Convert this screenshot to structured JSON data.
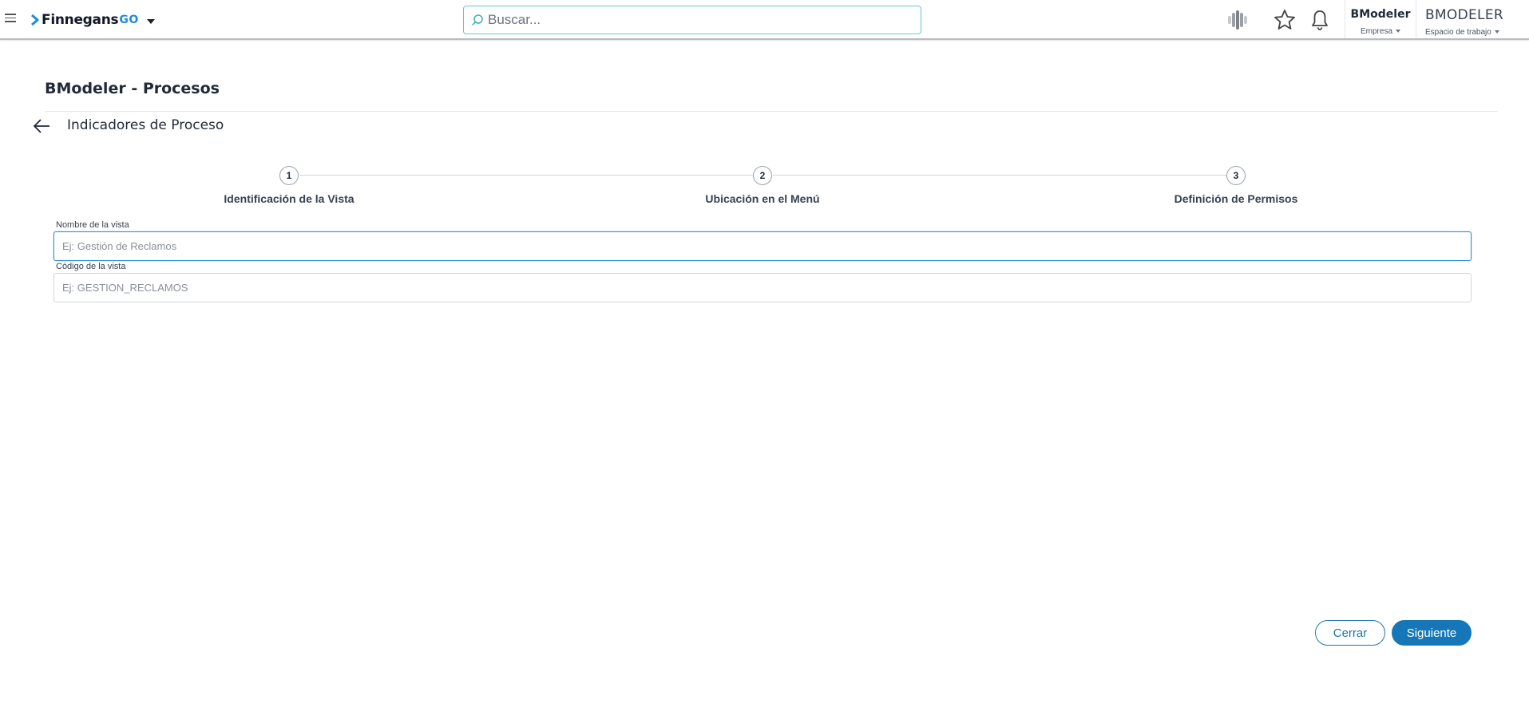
{
  "topbar": {
    "brand": "Finnegans",
    "brand_suffix": "GO",
    "search_placeholder": "Buscar...",
    "company": {
      "name": "BModeler",
      "label": "Empresa"
    },
    "workspace": {
      "name": "BMODELER",
      "label": "Espacio de trabajo"
    }
  },
  "page": {
    "title": "BModeler - Procesos",
    "subtitle": "Indicadores de Proceso"
  },
  "stepper": {
    "steps": [
      {
        "number": "1",
        "label": "Identificación de la Vista"
      },
      {
        "number": "2",
        "label": "Ubicación en el Menú"
      },
      {
        "number": "3",
        "label": "Definición de Permisos"
      }
    ]
  },
  "form": {
    "view_name": {
      "label": "Nombre de la vista",
      "placeholder": "Ej: Gestión de Reclamos",
      "value": ""
    },
    "view_code": {
      "label": "Código de la vista",
      "placeholder": "Ej: GESTION_RECLAMOS",
      "value": ""
    }
  },
  "actions": {
    "close_label": "Cerrar",
    "next_label": "Siguiente"
  },
  "colors": {
    "accent": "#1677b8",
    "brand_go": "#1d8bd8",
    "search_border": "#5ec8d8"
  }
}
